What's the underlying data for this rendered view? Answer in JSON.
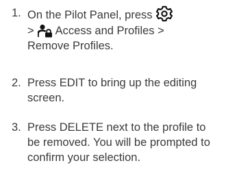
{
  "steps": [
    {
      "number": "1.",
      "line1_text": "On the Pilot Panel, press",
      "line1_icon": "gear-icon",
      "line2_prefix": ">",
      "line2_icon": "person-lock-icon",
      "line2_text": "Access and Profiles >",
      "line3_text": "Remove Profiles."
    },
    {
      "number": "2.",
      "line1_text": "Press EDIT to bring up the editing",
      "line2_text": "screen."
    },
    {
      "number": "3.",
      "line1_text": "Press DELETE next to the profile to",
      "line2_text": "be removed. You will be prompted to",
      "line3_text": "confirm your selection."
    }
  ]
}
